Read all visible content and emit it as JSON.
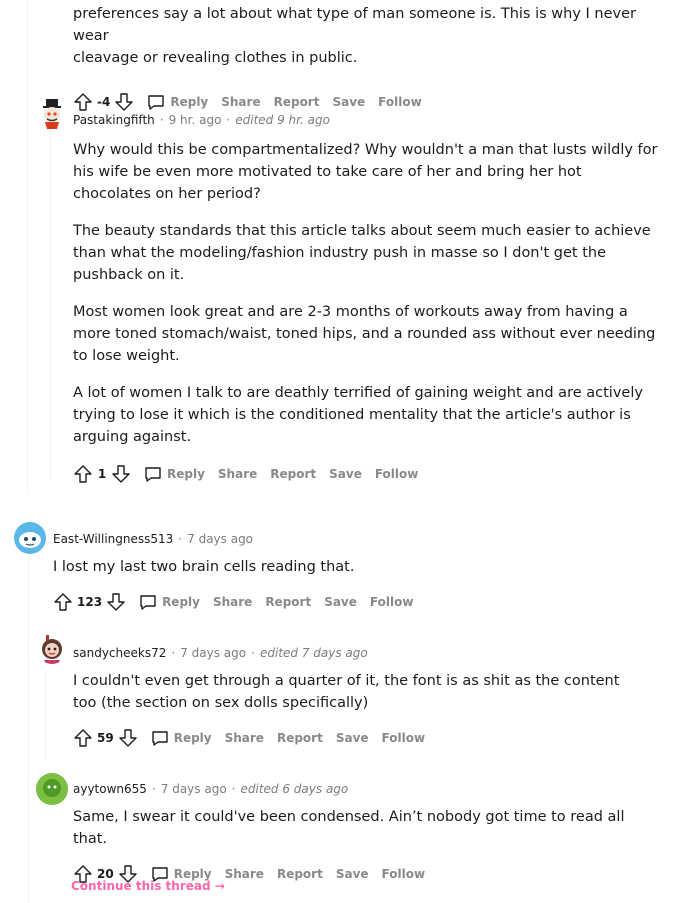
{
  "top_comment": {
    "lines": [
      "preferences say a lot about what type of man someone is. This is why I never wear",
      "cleavage or revealing clothes in public."
    ],
    "score": "-4"
  },
  "actions": {
    "reply": "Reply",
    "share": "Share",
    "report": "Report",
    "save": "Save",
    "follow": "Follow"
  },
  "comments": [
    {
      "author": "Pastakingfifth",
      "time": "9 hr. ago",
      "edited": "edited 9 hr. ago",
      "paragraphs": [
        "Why would this be compartmentalized? Why wouldn't a man that lusts wildly for his wife be even more motivated to take care of her and bring her hot chocolates on her period?",
        "The beauty standards that this article talks about seem much easier to achieve than what the modeling/fashion industry push in masse so I don't get the pushback on it.",
        "Most women look great and are 2-3 months of workouts away from having a more toned stomach/waist, toned hips, and a rounded ass without ever needing to lose weight.",
        "A lot of women I talk to are deathly terrified of gaining weight and are actively trying to lose it which is the conditioned mentality that the article's author is arguing against."
      ],
      "score": "1"
    },
    {
      "author": "East-Willingness513",
      "time": "7 days ago",
      "edited": "",
      "paragraphs": [
        "I lost my last two brain cells reading that."
      ],
      "score": "123"
    },
    {
      "author": "sandycheeks72",
      "time": "7 days ago",
      "edited": "edited 7 days ago",
      "paragraphs": [
        "I couldn't even get through a quarter of it, the font is as shit as the content too (the section on sex dolls specifically)"
      ],
      "score": "59"
    },
    {
      "author": "ayytown655",
      "time": "7 days ago",
      "edited": "edited 6 days ago",
      "paragraphs": [
        "Same, I swear it could've been condensed. Ain’t nobody got time to read all that."
      ],
      "score": "20"
    }
  ],
  "continue_thread": "Continue this thread →",
  "colors": {
    "link": "#ff66ac",
    "muted": "#878a8c",
    "text": "#1c1c1c"
  }
}
